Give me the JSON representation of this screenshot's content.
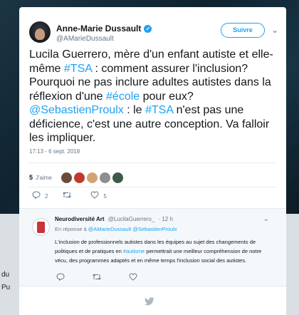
{
  "background": {
    "text_1": "du",
    "text_2": "Pu"
  },
  "tweet": {
    "author_name": "Anne-Marie Dussault",
    "author_handle": "@AMarieDussault",
    "verified_glyph": "✓",
    "follow_label": "Suivre",
    "menu_glyph": "⌄",
    "text_parts": {
      "p1": "Lucila Guerrero, mère d'un enfant autiste et elle-même ",
      "tag1": "#TSA",
      "p2": " : comment assurer l'inclusion? Pourquoi ne pas inclure adultes autistes dans la réflexion d'une ",
      "tag2": "#école",
      "p3": " pour eux? ",
      "mention1": "@SebastienProulx",
      "p4": " : le ",
      "tag3": "#TSA",
      "p5": " n'est pas une déficience, c'est une autre conception. Va falloir les impliquer."
    },
    "timestamp": "17:13 - 6 sept. 2018",
    "likes_count": "5",
    "likes_label": "J'aime",
    "liker_colors": [
      "#6b4a3a",
      "#c0392b",
      "#d4a373",
      "#8e8e8e",
      "#3d5a4a"
    ],
    "actions": {
      "reply_icon": "reply-icon",
      "reply_count": "2",
      "retweet_icon": "retweet-icon",
      "retweet_count": "",
      "like_icon": "heart-icon",
      "like_count": "5"
    }
  },
  "reply": {
    "author_name": "Neurodiversité Art",
    "author_handle": "@LucilaGuerrero_",
    "age": "· 12 h",
    "menu_glyph": "⌄",
    "reply_to_prefix": "En réponse à ",
    "reply_to_1": "@AMarieDussault",
    "reply_to_2": "@SebastienProulx",
    "text_parts": {
      "p1": "L'inclusion de professionnels autistes dans les équipes au sujet des changements de politiques et de pratiques en ",
      "tag": "#autisme",
      "p2": " permettrait une meilleur compréhension de notre vécu, des programmes adaptés et en même temps l'inclusion social des autistes."
    }
  },
  "colors": {
    "accent": "#1da1f2",
    "text": "#14171a",
    "muted": "#657786"
  }
}
